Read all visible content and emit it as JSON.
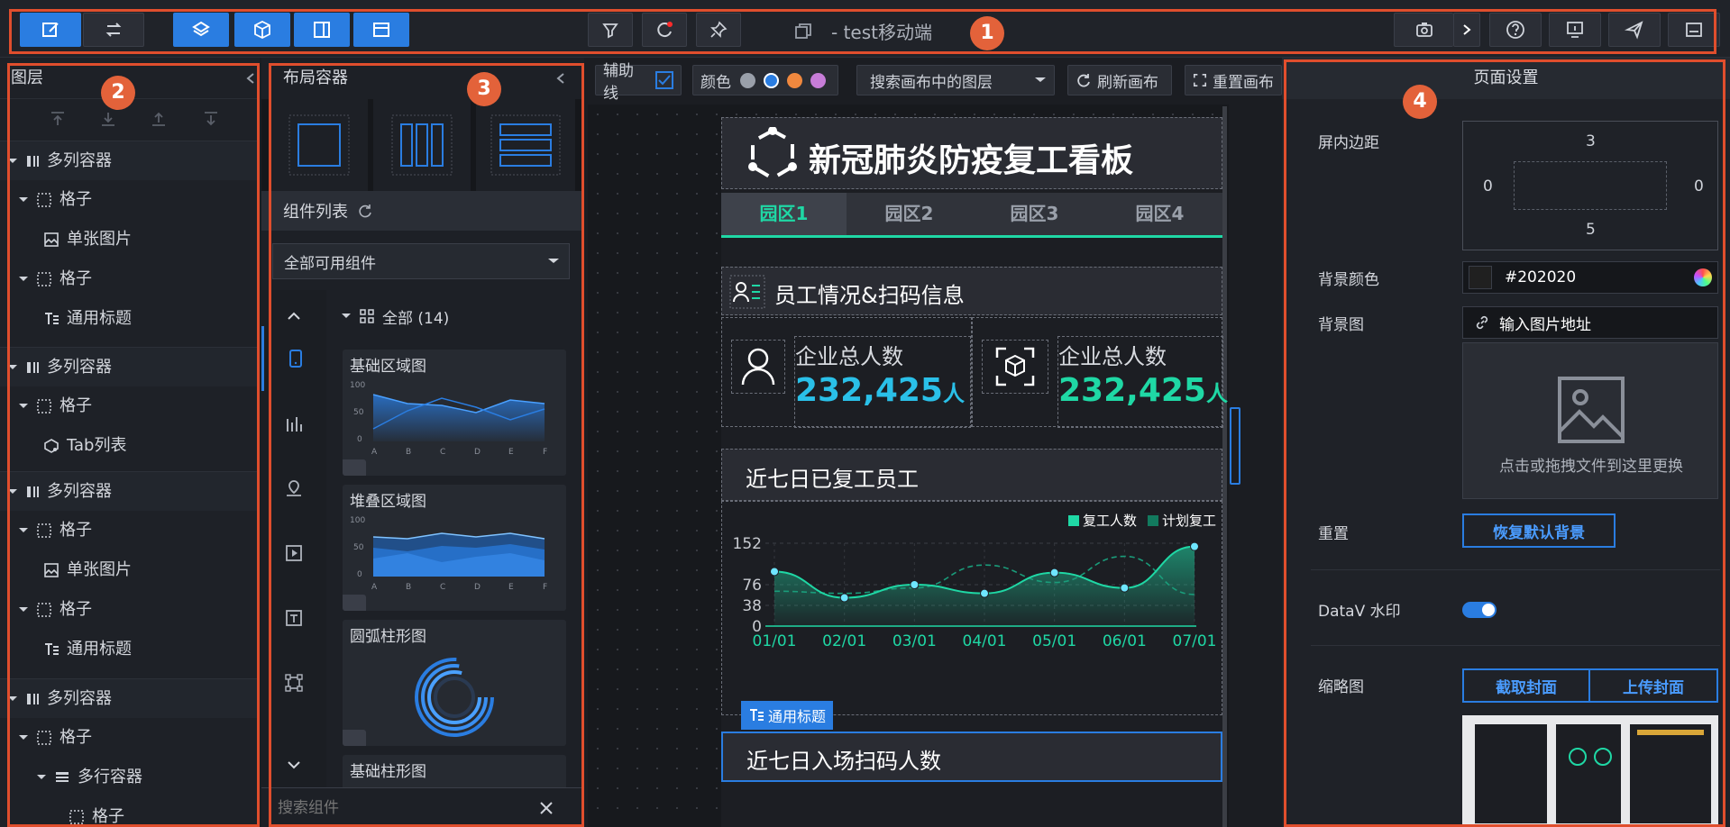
{
  "toolbar": {
    "title": "- test移动端",
    "left_icons": [
      "edit-icon",
      "swap-icon"
    ],
    "view_icons": [
      "layers-icon",
      "cube-icon",
      "split-icon",
      "panel-icon"
    ],
    "center_icons": [
      "filter-icon",
      "refresh-icon",
      "pin-icon"
    ],
    "right_icons": [
      "camera-icon",
      "chevron-right-icon",
      "help-icon",
      "preview-icon",
      "publish-icon",
      "screen-icon"
    ]
  },
  "annotations": [
    "1",
    "2",
    "3",
    "4"
  ],
  "layers": {
    "title": "图层",
    "items": [
      {
        "label": "多列容器",
        "level": 0,
        "icon": "columns-icon"
      },
      {
        "label": "格子",
        "level": 1,
        "icon": "grid-icon"
      },
      {
        "label": "单张图片",
        "level": 2,
        "icon": "image-icon"
      },
      {
        "label": "格子",
        "level": 1,
        "icon": "grid-icon"
      },
      {
        "label": "通用标题",
        "level": 2,
        "icon": "title-icon"
      },
      {
        "label": "多列容器",
        "level": 0,
        "icon": "columns-icon"
      },
      {
        "label": "格子",
        "level": 1,
        "icon": "grid-icon"
      },
      {
        "label": "Tab列表",
        "level": 2,
        "icon": "tab-icon"
      },
      {
        "label": "多列容器",
        "level": 0,
        "icon": "columns-icon"
      },
      {
        "label": "格子",
        "level": 1,
        "icon": "grid-icon"
      },
      {
        "label": "单张图片",
        "level": 2,
        "icon": "image-icon"
      },
      {
        "label": "格子",
        "level": 1,
        "icon": "grid-icon"
      },
      {
        "label": "通用标题",
        "level": 2,
        "icon": "title-icon"
      },
      {
        "label": "多列容器",
        "level": 0,
        "icon": "columns-icon"
      },
      {
        "label": "格子",
        "level": 1,
        "icon": "grid-icon"
      },
      {
        "label": "多行容器",
        "level": 2,
        "icon": "rows-icon"
      },
      {
        "label": "格子",
        "level": 3,
        "icon": "grid-icon"
      }
    ]
  },
  "components": {
    "title": "布局容器",
    "list_title": "组件列表",
    "filter_value": "全部可用组件",
    "group_label": "全部 (14)",
    "search_placeholder": "搜索组件",
    "cards": [
      {
        "title": "基础区域图",
        "axis": [
          "A",
          "B",
          "C",
          "D",
          "E",
          "F"
        ],
        "yticks": [
          "100",
          "50",
          "0"
        ]
      },
      {
        "title": "堆叠区域图",
        "axis": [
          "A",
          "B",
          "C",
          "D",
          "E",
          "F"
        ],
        "yticks": [
          "100",
          "50",
          "0"
        ]
      },
      {
        "title": "圆弧柱形图"
      },
      {
        "title": "基础柱形图"
      }
    ]
  },
  "canvas_toolbar": {
    "guides_label": "辅助线",
    "color_label": "颜色",
    "colors": [
      "#9aa0aa",
      "#2a7de1",
      "#f0883e",
      "#c77dd8"
    ],
    "search_placeholder": "搜索画布中的图层",
    "refresh_label": "刷新画布",
    "reset_label": "重置画布"
  },
  "dashboard": {
    "title": "新冠肺炎防疫复工看板",
    "tabs": [
      "园区1",
      "园区2",
      "园区3",
      "园区4"
    ],
    "section1_title": "员工情况&扫码信息",
    "stat_label": "企业总人数",
    "stat1_value": "232,425",
    "stat2_value": "232,425",
    "stat_unit": "人",
    "section2_title": "近七日已复工员工",
    "legend": [
      "复工人数",
      "计划复工"
    ],
    "tag_label": "通用标题",
    "section3_title": "近七日入场扫码人数"
  },
  "chart_data": {
    "type": "line",
    "categories": [
      "01/01",
      "02/01",
      "03/01",
      "04/01",
      "05/01",
      "06/01",
      "07/01"
    ],
    "yticks": [
      0,
      38,
      76,
      152
    ],
    "ylim": [
      0,
      152
    ],
    "series": [
      {
        "name": "复工人数",
        "values": [
          100,
          52,
          76,
          60,
          98,
          70,
          146
        ]
      },
      {
        "name": "计划复工",
        "values": [
          64,
          60,
          70,
          112,
          80,
          128,
          58
        ]
      }
    ]
  },
  "settings": {
    "title": "页面设置",
    "padding_label": "屏内边距",
    "padding": {
      "top": "3",
      "left": "0",
      "right": "0",
      "bottom": "5"
    },
    "bg_color_label": "背景颜色",
    "bg_color_value": "#202020",
    "bg_image_label": "背景图",
    "bg_image_placeholder": "输入图片地址",
    "upload_hint": "点击或拖拽文件到这里更换",
    "reset_label": "重置",
    "reset_button": "恢复默认背景",
    "watermark_label": "DataV 水印",
    "thumbnail_label": "缩略图",
    "capture_button": "截取封面",
    "upload_button": "上传封面"
  },
  "colors": {
    "accent": "#2a7de1",
    "green": "#1fd8a5",
    "cyan": "#2ac0e8",
    "annotation": "#e04e2d"
  }
}
